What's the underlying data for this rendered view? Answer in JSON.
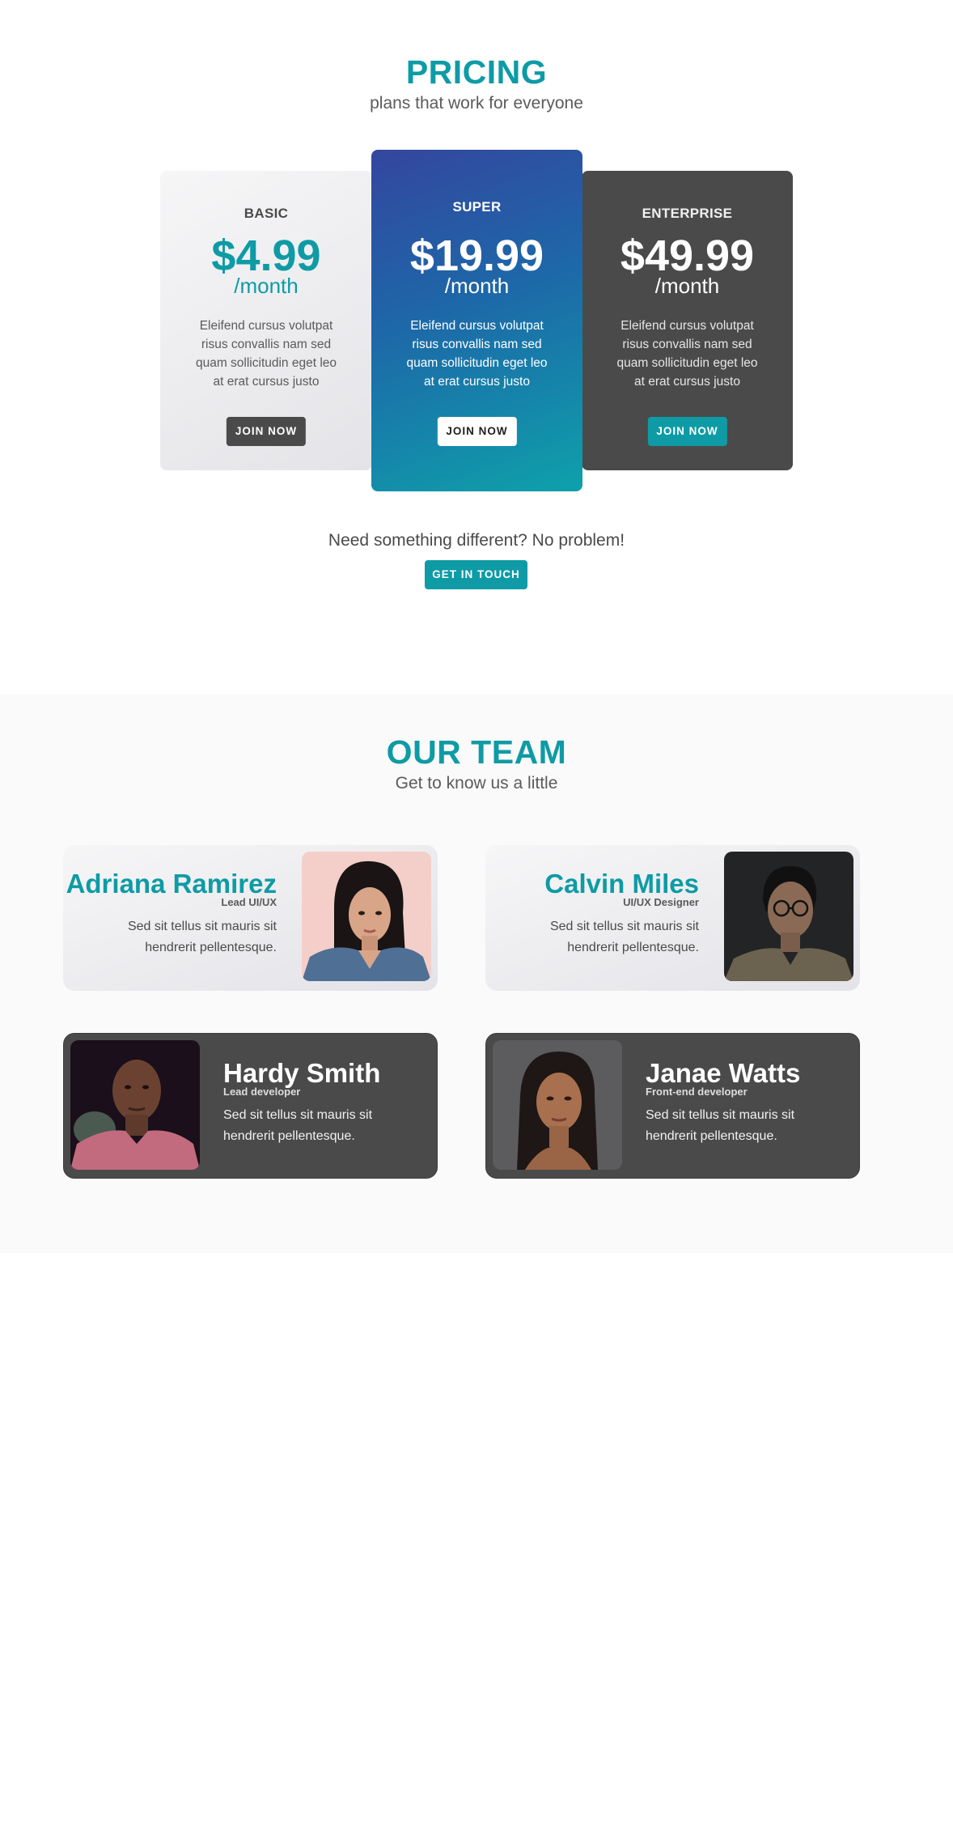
{
  "pricing": {
    "title": "PRICING",
    "subtitle": "plans that work for everyone",
    "plans": [
      {
        "name": "BASIC",
        "price": "$4.99",
        "period": "/month",
        "description": "Eleifend cursus volutpat risus convallis nam sed quam sollicitudin eget leo at erat cursus justo",
        "button": "JOIN NOW"
      },
      {
        "name": "SUPER",
        "price": "$19.99",
        "period": "/month",
        "description": "Eleifend cursus volutpat risus convallis nam sed quam sollicitudin eget leo at erat cursus justo",
        "button": "JOIN NOW"
      },
      {
        "name": "ENTERPRISE",
        "price": "$49.99",
        "period": "/month",
        "description": "Eleifend cursus volutpat risus convallis nam sed quam sollicitudin eget leo at erat cursus justo",
        "button": "JOIN NOW"
      }
    ],
    "cta_text": "Need something different? No problem!",
    "cta_button": "GET IN TOUCH"
  },
  "team": {
    "title": "OUR TEAM",
    "subtitle": "Get to know us a little",
    "members": [
      {
        "name": "Adriana Ramirez",
        "role": "Lead UI/UX",
        "bio": "Sed sit tellus sit mauris sit hendrerit pellentesque."
      },
      {
        "name": "Calvin Miles",
        "role": "UI/UX Designer",
        "bio": "Sed sit tellus sit mauris sit hendrerit pellentesque."
      },
      {
        "name": "Hardy Smith",
        "role": "Lead developer",
        "bio": "Sed sit tellus sit mauris sit hendrerit pellentesque."
      },
      {
        "name": "Janae Watts",
        "role": "Front-end developer",
        "bio": "Sed sit tellus sit mauris sit hendrerit pellentesque."
      }
    ]
  },
  "colors": {
    "accent": "#0e9ba5",
    "dark": "#4a4a4a",
    "super_gradient_start": "#34469f",
    "super_gradient_end": "#0ea1ab"
  },
  "icons": [
    "portrait-photo"
  ]
}
